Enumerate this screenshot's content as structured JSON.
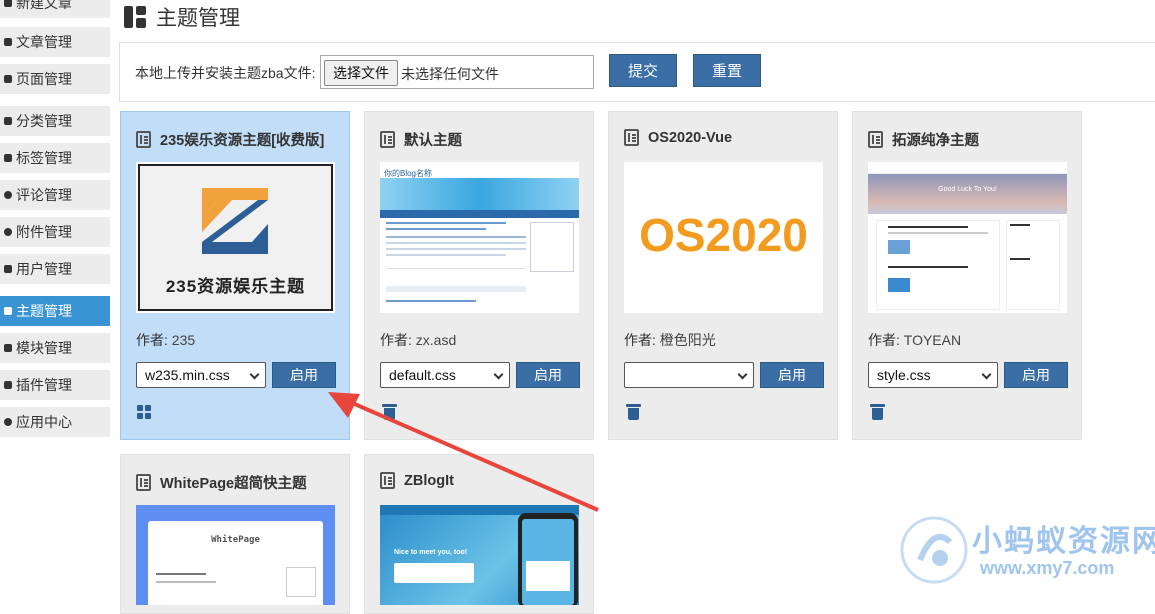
{
  "sidebar": {
    "items": [
      {
        "label": "新建文章",
        "active": false
      },
      {
        "label": "文章管理",
        "active": false
      },
      {
        "label": "页面管理",
        "active": false
      },
      {
        "label": "分类管理",
        "active": false
      },
      {
        "label": "标签管理",
        "active": false
      },
      {
        "label": "评论管理",
        "active": false
      },
      {
        "label": "附件管理",
        "active": false
      },
      {
        "label": "用户管理",
        "active": false
      },
      {
        "label": "主题管理",
        "active": true
      },
      {
        "label": "模块管理",
        "active": false
      },
      {
        "label": "插件管理",
        "active": false
      },
      {
        "label": "应用中心",
        "active": false
      }
    ]
  },
  "page_title": "主题管理",
  "upload": {
    "label": "本地上传并安装主题zba文件:",
    "choose_file": "选择文件",
    "no_file": "未选择任何文件",
    "submit": "提交",
    "reset": "重置"
  },
  "author_label": "作者:",
  "enable_label": "启用",
  "themes": [
    {
      "name": "235娱乐资源主题[收费版]",
      "author": "235",
      "style": "w235.min.css",
      "active": true,
      "thumb_text": "235资源娱乐主题"
    },
    {
      "name": "默认主题",
      "author": "zx.asd",
      "style": "default.css",
      "active": false,
      "thumb_text": "你的Blog名称"
    },
    {
      "name": "OS2020-Vue",
      "author": "橙色阳光",
      "style": "",
      "active": false,
      "thumb_text": "OS2020"
    },
    {
      "name": "拓源纯净主题",
      "author": "TOYEAN",
      "style": "style.css",
      "active": false,
      "thumb_text": "Good Luck To You!"
    },
    {
      "name": "WhitePage超简快主题",
      "author": "",
      "style": "",
      "active": false,
      "thumb_text": "WhitePage"
    },
    {
      "name": "ZBlogIt",
      "author": "",
      "style": "",
      "active": false,
      "thumb_text": "Nice to meet you, too!"
    }
  ],
  "watermark": {
    "title": "小蚂蚁资源网",
    "url": "www.xmy7.com"
  },
  "colors": {
    "accent": "#3a94d4",
    "button": "#3a6ea5",
    "active_card": "#c1ddf7",
    "arrow": "#e8453c"
  }
}
